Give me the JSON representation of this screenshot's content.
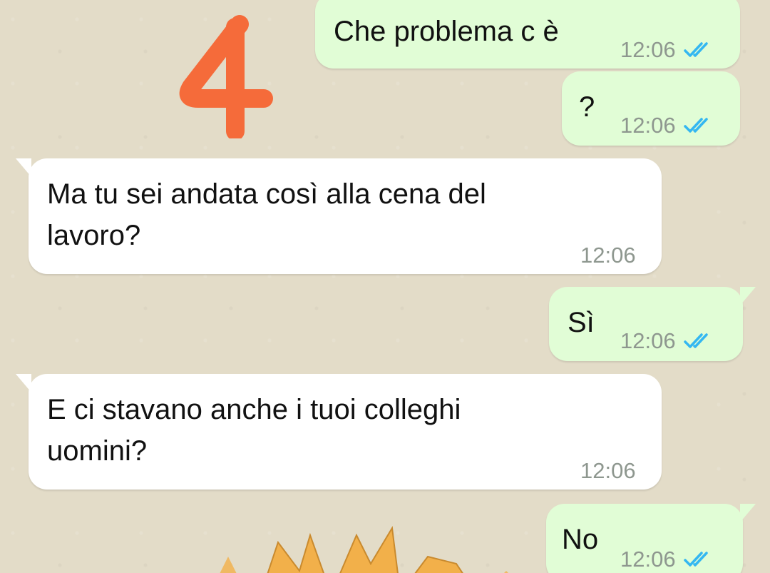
{
  "annotation": {
    "number": "4",
    "color": "#f56b3a"
  },
  "theme": {
    "outgoing": "#e1fdd6",
    "incoming": "#ffffff",
    "tick_color": "#34b7f1"
  },
  "messages": [
    {
      "direction": "outgoing",
      "text": "Che problema c è",
      "time": "12:06",
      "status": "read"
    },
    {
      "direction": "outgoing",
      "text": "?",
      "time": "12:06",
      "status": "read"
    },
    {
      "direction": "incoming",
      "text_line1": "Ma tu sei andata così alla cena del",
      "text_line2": "lavoro?",
      "time": "12:06"
    },
    {
      "direction": "outgoing",
      "text": "Sì",
      "time": "12:06",
      "status": "read"
    },
    {
      "direction": "incoming",
      "text_line1": "E ci stavano anche i tuoi colleghi",
      "text_line2": "uomini?",
      "time": "12:06"
    },
    {
      "direction": "outgoing",
      "text": "No",
      "time": "12:06",
      "status": "read"
    }
  ]
}
